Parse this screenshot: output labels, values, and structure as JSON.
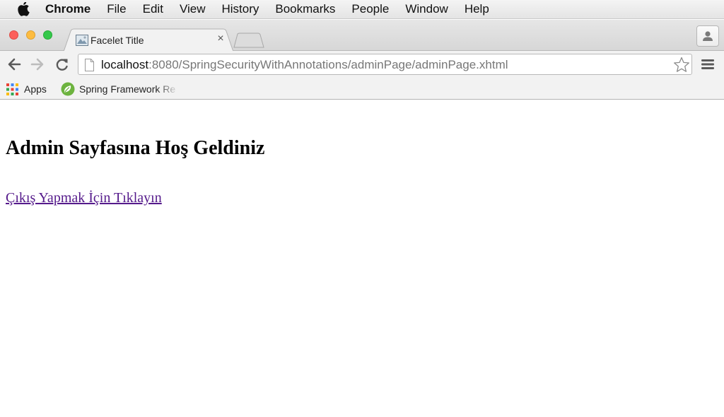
{
  "menubar": {
    "app_name": "Chrome",
    "items": [
      "File",
      "Edit",
      "View",
      "History",
      "Bookmarks",
      "People",
      "Window",
      "Help"
    ]
  },
  "tab": {
    "title": "Facelet Title",
    "close_glyph": "×"
  },
  "address_bar": {
    "host": "localhost",
    "rest": ":8080/SpringSecurityWithAnnotations/adminPage/adminPage.xhtml"
  },
  "bookmarks": {
    "apps_label": "Apps",
    "spring_label": "Spring Framework Re"
  },
  "page": {
    "heading": "Admin Sayfasına Hoş Geldiniz",
    "logout_link": "Çıkış Yapmak İçin Tıklayın"
  },
  "colors": {
    "visited_link": "#551a8b",
    "traffic_close": "#fc605b",
    "traffic_minimize": "#fdbc40",
    "traffic_maximize": "#34c84a"
  },
  "icons": [
    "apple-icon",
    "back-icon",
    "forward-icon",
    "reload-icon",
    "page-icon",
    "star-icon",
    "hamburger-menu-icon",
    "profile-icon",
    "apps-grid-icon",
    "spring-leaf-icon",
    "tab-favicon"
  ]
}
